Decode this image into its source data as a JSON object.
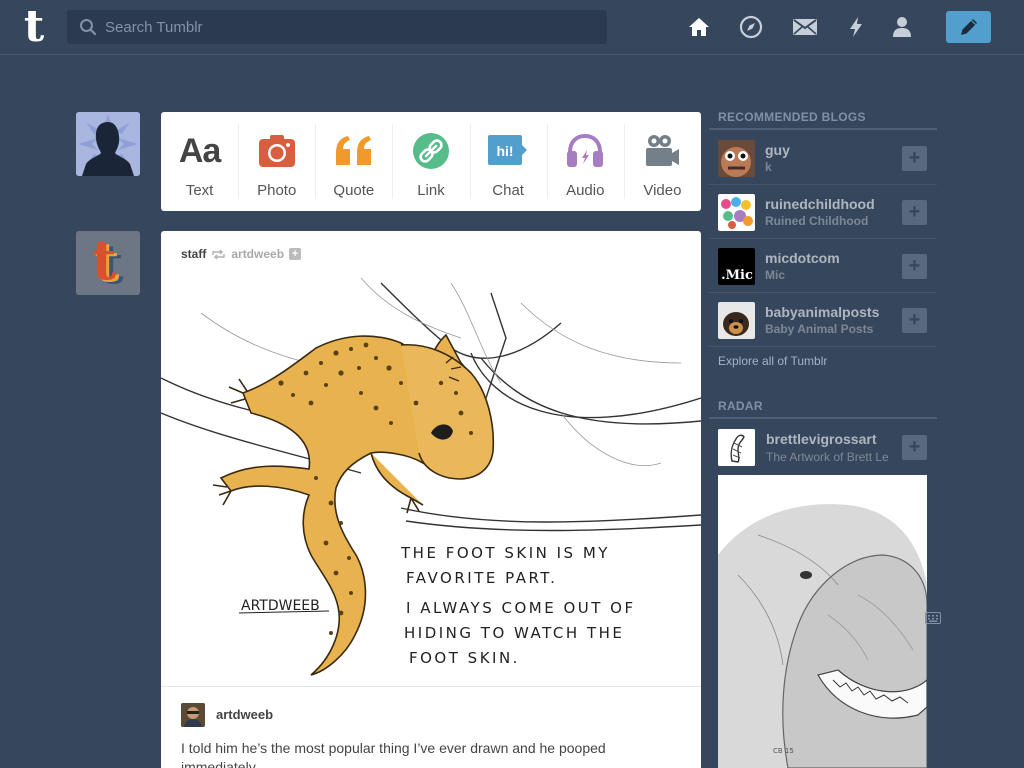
{
  "header": {
    "logo": "t",
    "search_placeholder": "Search Tumblr",
    "nav": [
      "home-icon",
      "explore-icon",
      "inbox-icon",
      "activity-icon",
      "account-icon"
    ],
    "compose": "compose-icon",
    "accent": "#529ecc"
  },
  "post_types": [
    {
      "label": "Text",
      "icon": "text-icon",
      "color": "#444444"
    },
    {
      "label": "Photo",
      "icon": "camera-icon",
      "color": "#d95e40"
    },
    {
      "label": "Quote",
      "icon": "quote-icon",
      "color": "#f2992e"
    },
    {
      "label": "Link",
      "icon": "link-icon",
      "color": "#56bc8a"
    },
    {
      "label": "Chat",
      "icon": "chat-icon",
      "color": "#529ecc"
    },
    {
      "label": "Audio",
      "icon": "headphones-icon",
      "color": "#a77dc2"
    },
    {
      "label": "Video",
      "icon": "video-camera-icon",
      "color": "#748089"
    }
  ],
  "post": {
    "author": "staff",
    "source": "artdweeb",
    "art_signature": "ARTDWEEB",
    "art_caption": [
      "THE FOOT SKIN IS MY",
      "FAVORITE PART.",
      "I ALWAYS COME OUT OF",
      "HIDING TO WATCH THE",
      "FOOT SKIN."
    ],
    "reblog_name": "artdweeb",
    "body": "I told him he’s the most popular thing I’ve ever drawn and he pooped immediately."
  },
  "sidebar": {
    "recommended_heading": "RECOMMENDED BLOGS",
    "recommended": [
      {
        "name": "guy",
        "title": "k"
      },
      {
        "name": "ruinedchildhood",
        "title": "Ruined Childhood"
      },
      {
        "name": "micdotcom",
        "title": "Mic",
        "avatar_text": ".Mic"
      },
      {
        "name": "babyanimalposts",
        "title": "Baby Animal Posts"
      }
    ],
    "explore": "Explore all of Tumblr",
    "radar_heading": "RADAR",
    "radar": {
      "name": "brettlevigrossart",
      "title": "The Artwork of Brett Le"
    }
  }
}
